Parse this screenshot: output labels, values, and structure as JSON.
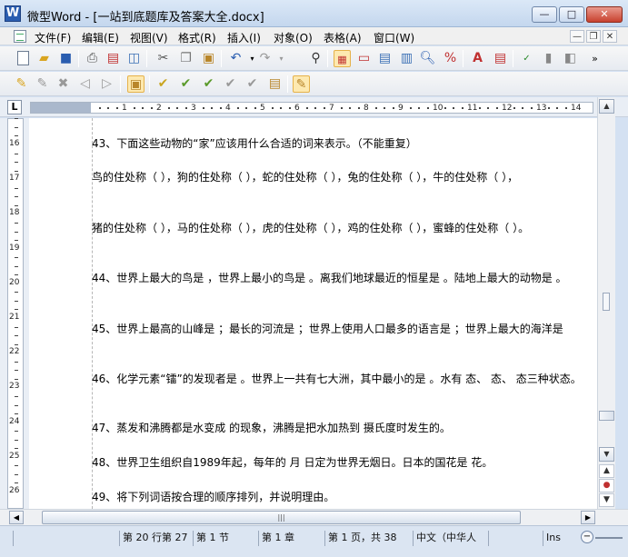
{
  "window": {
    "app_icon_letter": "W",
    "title": "微型Word - [一站到底题库及答案大全.docx]",
    "minimize_label": "—",
    "maximize_label": "□",
    "close_label": "✕"
  },
  "menu": {
    "items": [
      "文件(F)",
      "编辑(E)",
      "视图(V)",
      "格式(R)",
      "插入(I)",
      "对象(O)",
      "表格(A)",
      "窗口(W)"
    ],
    "mdi_minimize": "—",
    "mdi_restore": "❐",
    "mdi_close": "✕"
  },
  "ruler": {
    "corner_label": "L",
    "numbers": [
      "1",
      "2",
      "3",
      "4",
      "5",
      "6",
      "7",
      "8",
      "9",
      "10",
      "11",
      "12",
      "13",
      "14"
    ]
  },
  "vertical_ruler": {
    "numbers": [
      "16",
      "17",
      "18",
      "19",
      "20",
      "21",
      "22",
      "23",
      "24",
      "25",
      "26"
    ]
  },
  "document": {
    "paragraphs": [
      "43、下面这些动物的“家”应该用什么合适的词来表示。（不能重复）",
      "鸟的住处称（ ），狗的住处称（ ），蛇的住处称（ ），兔的住处称（ ），牛的住处称（ ），",
      "猪的住处称（ ），马的住处称（ ），虎的住处称（ ），鸡的住处称（ ），蜜蜂的住处称（ ）。",
      "44、世界上最大的鸟是 ，世界上最小的鸟是 。离我们地球最近的恒星是 。陆地上最大的动物是 。",
      "45、世界上最高的山峰是 ；最长的河流是 ；世界上使用人口最多的语言是 ；世界上最大的海洋是",
      "46、化学元素“镭”的发现者是 。世界上一共有七大洲，其中最小的是 。水有 态、 态、 态三种状态。",
      "47、蒸发和沸腾都是水变成 的现象，沸腾是把水加热到 摄氏度时发生的。",
      "48、世界卫生组织自1989年起，每年的 月 日定为世界无烟日。日本的国花是 花。",
      "49、将下列词语按合理的顺序排列，并说明理由。"
    ]
  },
  "status": {
    "line_col": "第 20 行第 27",
    "section": "第 1 节",
    "chapter": "第 1 章",
    "page": "第 1 页，共 38",
    "language": "中文（中华人",
    "mode": "Ins",
    "zoom_icon": "−"
  },
  "scroll": {
    "h_grip": "|||"
  }
}
